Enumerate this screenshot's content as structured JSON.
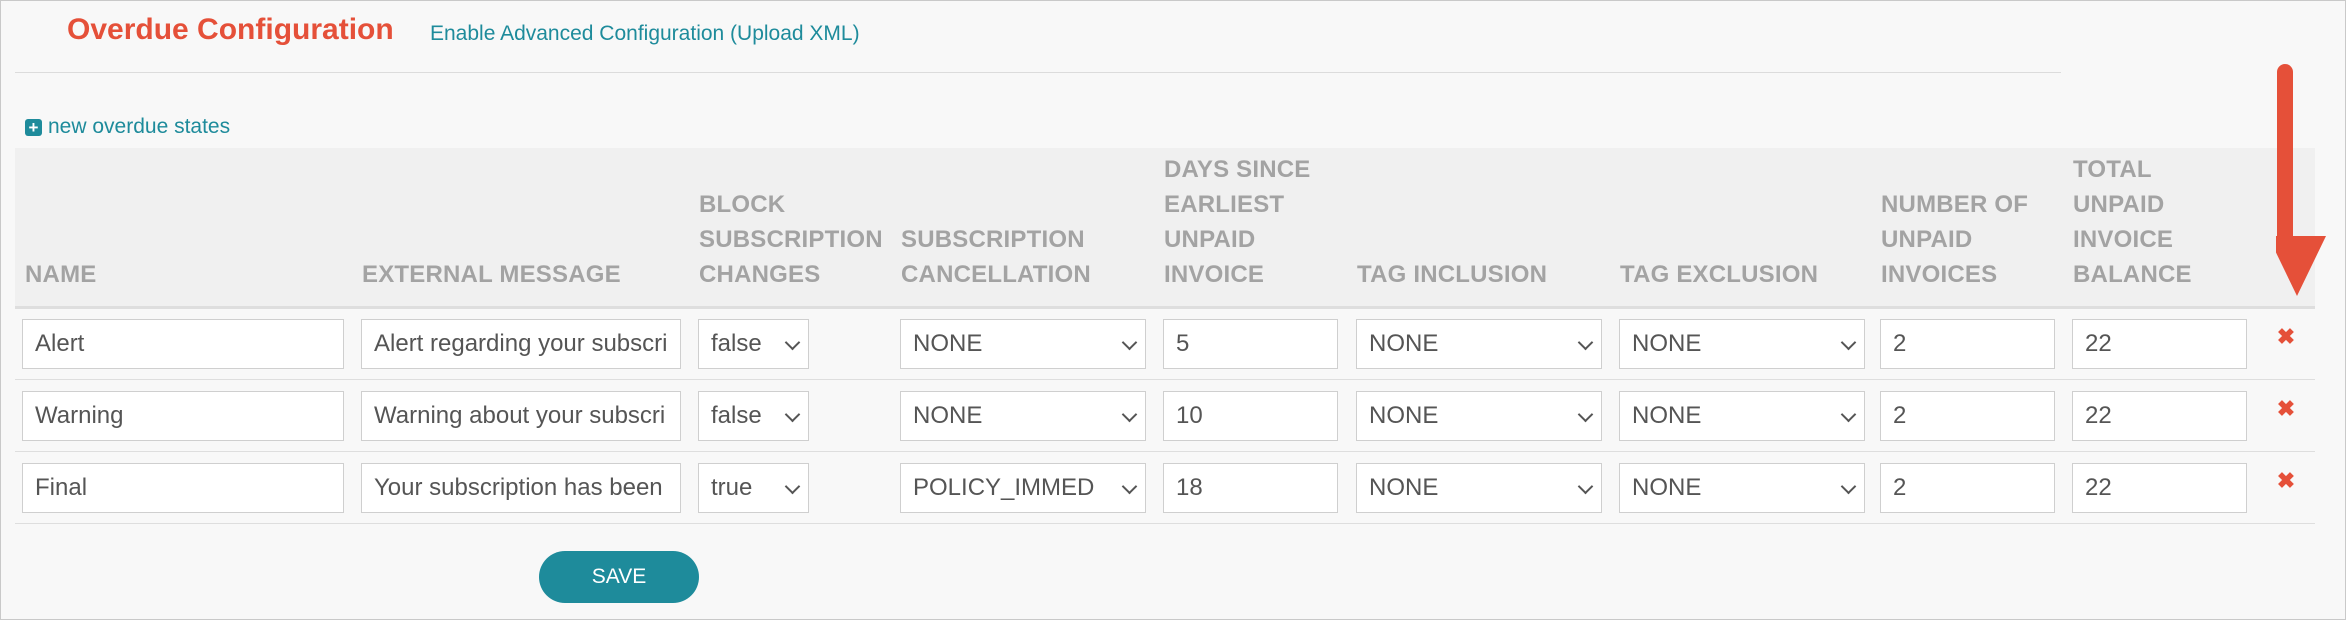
{
  "header": {
    "title": "Overdue Configuration",
    "advanced_link": "Enable Advanced Configuration (Upload XML)"
  },
  "new_states_link": "new overdue states",
  "columns": {
    "name": "NAME",
    "external_message": "EXTERNAL MESSAGE",
    "block_changes": [
      "BLOCK",
      "SUBSCRIPTION",
      "CHANGES"
    ],
    "cancellation": [
      "SUBSCRIPTION",
      "CANCELLATION"
    ],
    "days_since": [
      "DAYS SINCE",
      "EARLIEST",
      "UNPAID",
      "INVOICE"
    ],
    "tag_inclusion": "TAG INCLUSION",
    "tag_exclusion": "TAG EXCLUSION",
    "num_unpaid": [
      "NUMBER OF",
      "UNPAID",
      "INVOICES"
    ],
    "total_balance": [
      "TOTAL",
      "UNPAID",
      "INVOICE",
      "BALANCE"
    ]
  },
  "rows": [
    {
      "name": "Alert",
      "message": "Alert regarding your subscri",
      "block": "false",
      "cancellation": "NONE",
      "days": "5",
      "tag_inclusion": "NONE",
      "tag_exclusion": "NONE",
      "num_unpaid": "2",
      "balance": "22"
    },
    {
      "name": "Warning",
      "message": "Warning about your subscri",
      "block": "false",
      "cancellation": "NONE",
      "days": "10",
      "tag_inclusion": "NONE",
      "tag_exclusion": "NONE",
      "num_unpaid": "2",
      "balance": "22"
    },
    {
      "name": "Final",
      "message": "Your subscription has been",
      "block": "true",
      "cancellation": "POLICY_IMMED",
      "days": "18",
      "tag_inclusion": "NONE",
      "tag_exclusion": "NONE",
      "num_unpaid": "2",
      "balance": "22"
    }
  ],
  "save_label": "SAVE",
  "colors": {
    "accent": "#e55039",
    "link": "#1e8b9b",
    "header_text": "#a3a3a3"
  },
  "icons": {
    "add": "plus-square-icon",
    "delete": "close-icon",
    "annotation": "arrow-down-icon"
  }
}
